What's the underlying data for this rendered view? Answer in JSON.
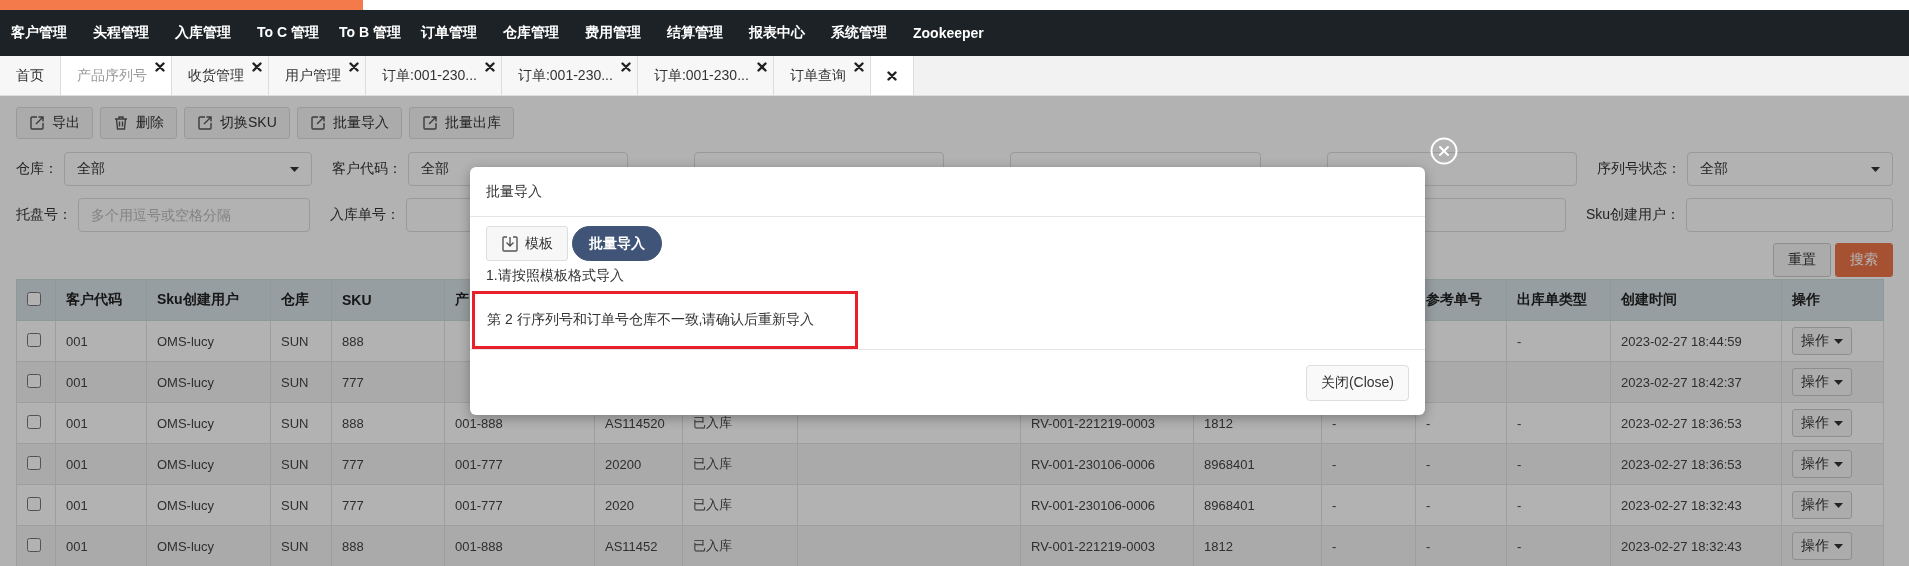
{
  "loading_bar": {
    "level": 0.19
  },
  "nav": {
    "items": [
      "客户管理",
      "头程管理",
      "入库管理",
      "To C 管理",
      "To B 管理",
      "订单管理",
      "仓库管理",
      "费用管理",
      "结算管理",
      "报表中心",
      "系统管理",
      "Zookeeper"
    ]
  },
  "tabs": [
    {
      "label": "首页",
      "selected": false,
      "closable": false
    },
    {
      "label": "产品序列号",
      "selected": true,
      "closable": true
    },
    {
      "label": "收货管理",
      "selected": false,
      "closable": true
    },
    {
      "label": "用户管理",
      "selected": false,
      "closable": true
    },
    {
      "label": "订单:001-230...",
      "selected": false,
      "closable": true
    },
    {
      "label": "订单:001-230...",
      "selected": false,
      "closable": true
    },
    {
      "label": "订单:001-230...",
      "selected": false,
      "closable": true
    },
    {
      "label": "订单查询",
      "selected": false,
      "closable": true
    }
  ],
  "toolbar": [
    {
      "label": "导出",
      "kind": "export"
    },
    {
      "label": "删除",
      "kind": "delete"
    },
    {
      "label": "切换SKU",
      "kind": "export"
    },
    {
      "label": "批量导入",
      "kind": "export"
    },
    {
      "label": "批量出库",
      "kind": "export"
    }
  ],
  "filters": [
    [
      {
        "label": "仓库：",
        "kind": "select",
        "value": "全部"
      },
      {
        "label": "客户代码：",
        "kind": "select",
        "value": "全部"
      },
      {
        "kind": "text"
      },
      {
        "kind": "text"
      },
      {
        "kind": "text"
      },
      {
        "label": "序列号状态：",
        "kind": "select",
        "value": "全部"
      }
    ],
    [
      {
        "label": "托盘号：",
        "kind": "text",
        "placeholder": "多个用逗号或空格分隔"
      },
      {
        "label": "入库单号：",
        "kind": "text"
      },
      {
        "kind": "text"
      },
      {
        "label": "Sku创建用户：",
        "kind": "text"
      }
    ]
  ],
  "actions": [
    {
      "label": "重置",
      "kind": "default"
    },
    {
      "label": "搜索",
      "kind": "primary"
    }
  ],
  "table": {
    "select_all": {
      "checked": false
    },
    "columns": [
      "客户代码",
      "Sku创建用户",
      "仓库",
      "SKU",
      "产",
      null,
      null,
      null,
      null,
      null,
      null,
      "参考单号",
      "出库单类型",
      "创建时间",
      "操作"
    ],
    "rows": [
      {
        "checked": false,
        "cells": [
          "001",
          "OMS-lucy",
          "SUN",
          "888",
          null,
          null,
          null,
          null,
          null,
          null,
          null,
          null,
          "-",
          "2023-02-27 18:44:59"
        ],
        "action": "操作"
      },
      {
        "checked": false,
        "cells": [
          "001",
          "OMS-lucy",
          "SUN",
          "777",
          null,
          null,
          null,
          null,
          null,
          null,
          null,
          null,
          null,
          "2023-02-27 18:42:37"
        ],
        "action": "操作"
      },
      {
        "checked": false,
        "cells": [
          "001",
          "OMS-lucy",
          "SUN",
          "888",
          "001-888",
          "AS114520",
          "已入库",
          null,
          "RV-001-221219-0003",
          "1812",
          "-",
          "-",
          "-",
          "2023-02-27 18:36:53"
        ],
        "action": "操作"
      },
      {
        "checked": false,
        "cells": [
          "001",
          "OMS-lucy",
          "SUN",
          "777",
          "001-777",
          "20200",
          "已入库",
          null,
          "RV-001-230106-0006",
          "8968401",
          "-",
          "-",
          "-",
          "2023-02-27 18:36:53"
        ],
        "action": "操作"
      },
      {
        "checked": false,
        "cells": [
          "001",
          "OMS-lucy",
          "SUN",
          "777",
          "001-777",
          "2020",
          "已入库",
          null,
          "RV-001-230106-0006",
          "8968401",
          "-",
          "-",
          "-",
          "2023-02-27 18:32:43"
        ],
        "action": "操作"
      },
      {
        "checked": false,
        "cells": [
          "001",
          "OMS-lucy",
          "SUN",
          "888",
          "001-888",
          "AS11452",
          "已入库",
          null,
          "RV-001-221219-0003",
          "1812",
          "-",
          "-",
          "-",
          "2023-02-27 18:32:43"
        ],
        "action": "操作"
      }
    ]
  },
  "modal": {
    "title": "批量导入",
    "buttons": [
      {
        "label": "模板",
        "kind": "download"
      },
      {
        "label": "批量导入",
        "kind": "primary"
      }
    ],
    "hint": "1.请按照模板格式导入",
    "error": "第 2 行序列号和订单号仓库不一致,请确认后重新导入",
    "footer_button": "关闭(Close)"
  }
}
